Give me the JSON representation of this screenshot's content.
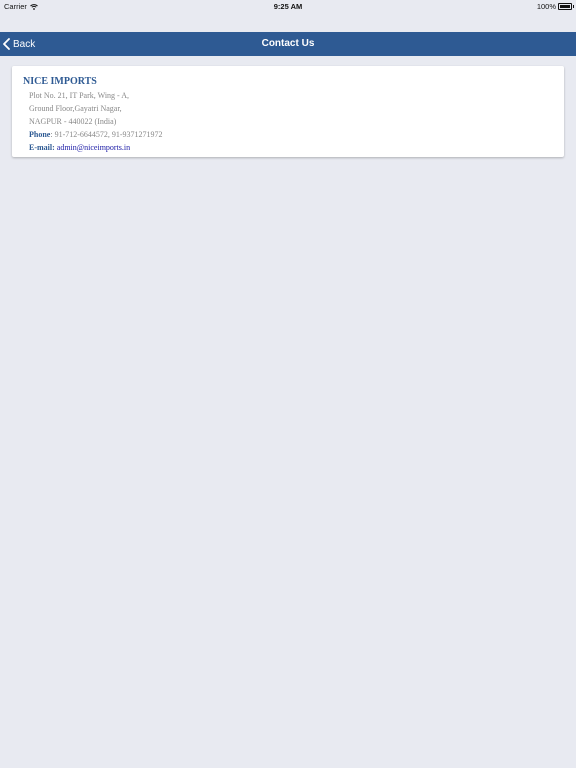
{
  "status_bar": {
    "carrier": "Carrier",
    "time": "9:25 AM",
    "battery": "100%"
  },
  "navbar": {
    "back_label": "Back",
    "title": "Contact Us"
  },
  "contact": {
    "company": "NICE IMPORTS",
    "address_line1": "Plot No. 21, IT Park, Wing - A,",
    "address_line2": "Ground Floor,Gayatri Nagar,",
    "address_line3": "NAGPUR - 440022 (India)",
    "phone_label": "Phone",
    "phone_value": ": 91-712-6644572, 91-9371271972",
    "email_label": "E-mail:",
    "email_value": "admin@niceimports.in"
  },
  "colors": {
    "navbar_bg": "#2e5a93",
    "page_bg": "#e8eaf1",
    "accent": "#2e5a93",
    "link": "#1a1aa6"
  },
  "icons": [
    "wifi-icon",
    "battery-icon",
    "chevron-left-icon"
  ]
}
